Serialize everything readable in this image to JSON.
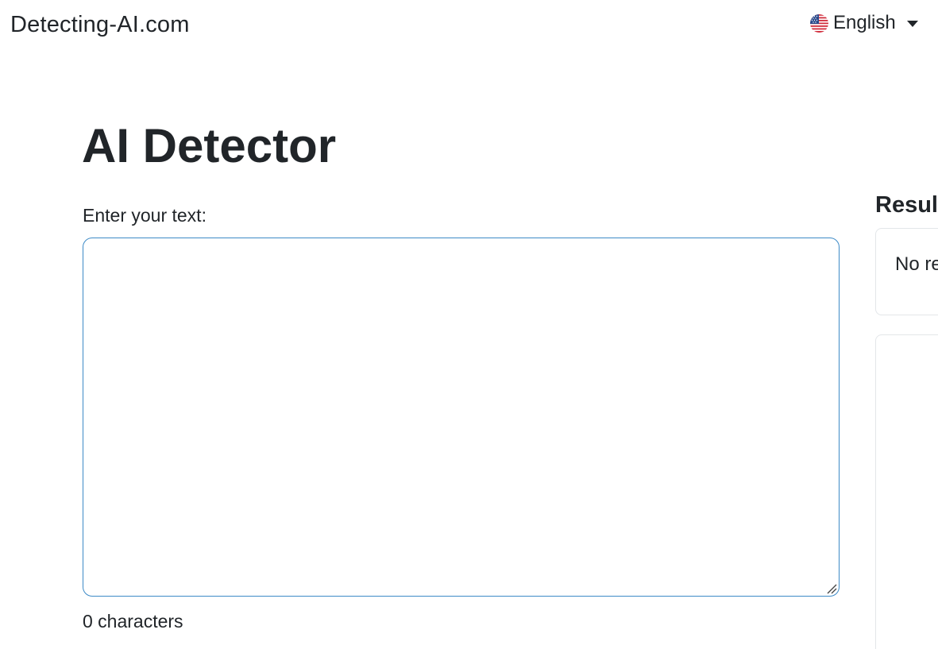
{
  "navbar": {
    "brand": "Detecting-AI.com",
    "language": {
      "label": "English",
      "flag_icon": "us-flag-icon"
    }
  },
  "main": {
    "title": "AI Detector",
    "input_label": "Enter your text:",
    "text_value": "",
    "character_count": "0 characters"
  },
  "result": {
    "heading": "Result",
    "text": "No results"
  },
  "colors": {
    "text": "#212529",
    "focus_border": "#3d8ac7",
    "card_border": "#e3e6e9"
  }
}
